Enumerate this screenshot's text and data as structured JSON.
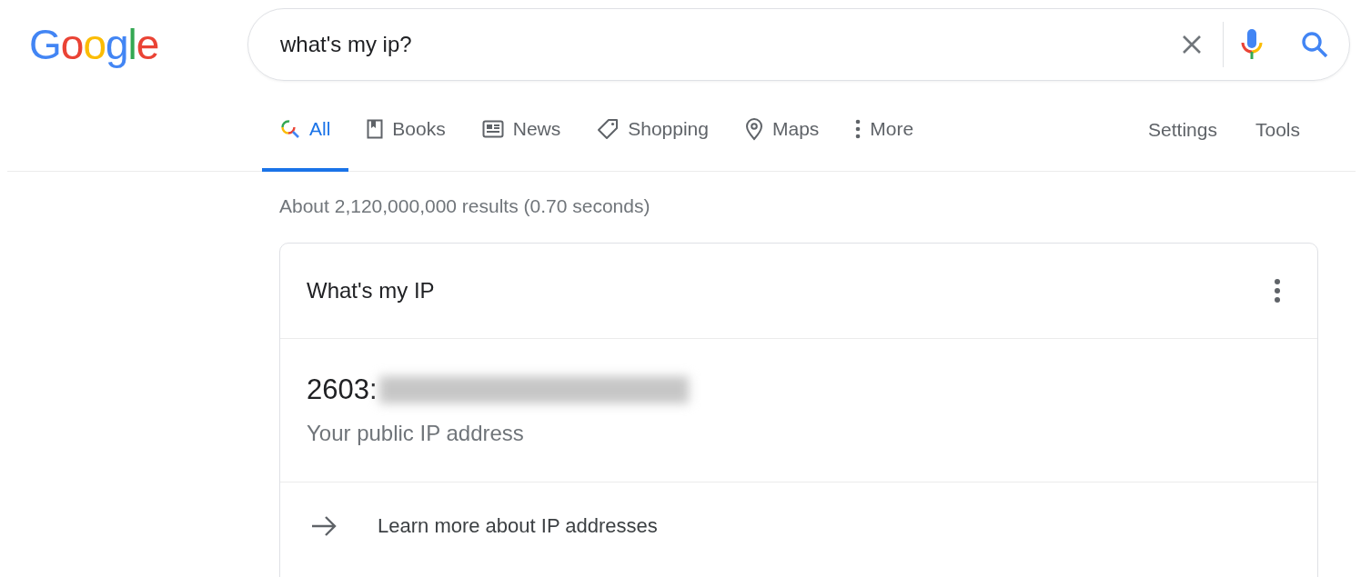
{
  "logo": "Google",
  "search": {
    "value": "what's my ip?"
  },
  "tabs": [
    {
      "label": "All",
      "kind": "all",
      "selected": true
    },
    {
      "label": "Books",
      "kind": "books",
      "selected": false
    },
    {
      "label": "News",
      "kind": "news",
      "selected": false
    },
    {
      "label": "Shopping",
      "kind": "shopping",
      "selected": false
    },
    {
      "label": "Maps",
      "kind": "maps",
      "selected": false
    },
    {
      "label": "More",
      "kind": "more",
      "selected": false
    }
  ],
  "tools": [
    "Settings",
    "Tools"
  ],
  "result_stats": "About 2,120,000,000 results (0.70 seconds)",
  "card": {
    "title": "What's my IP",
    "ip_visible": "2603:",
    "ip_redacted": true,
    "caption": "Your public IP address",
    "link": "Learn more about IP addresses"
  }
}
